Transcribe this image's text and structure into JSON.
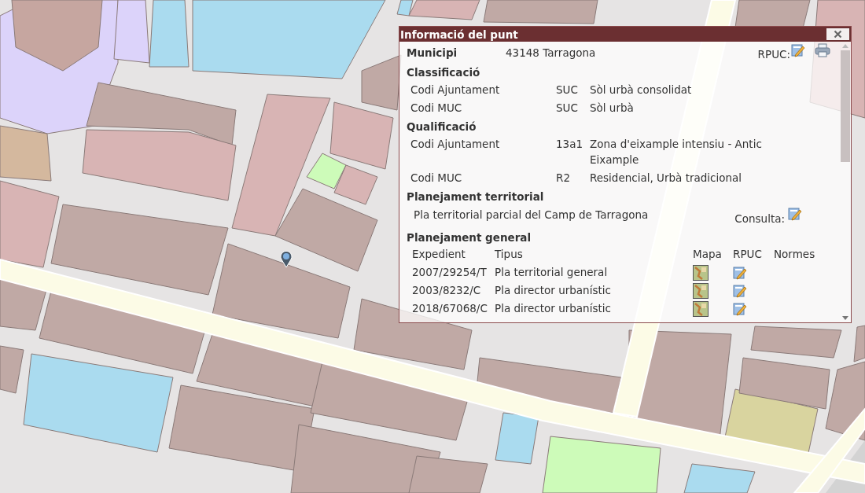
{
  "panel": {
    "title": "Informació del punt",
    "municipi": {
      "label": "Municipi",
      "value": "43148 Tarragona",
      "rpuc_label": "RPUC:"
    },
    "classificacio": {
      "heading": "Classificació",
      "rows": [
        {
          "label": "Codi Ajuntament",
          "code": "SUC",
          "description": "Sòl urbà consolidat"
        },
        {
          "label": "Codi MUC",
          "code": "SUC",
          "description": "Sòl urbà"
        }
      ]
    },
    "qualificacio": {
      "heading": "Qualificació",
      "rows": [
        {
          "label": "Codi Ajuntament",
          "code": "13a1",
          "description": "Zona d'eixample intensiu - Antic Eixample"
        },
        {
          "label": "Codi MUC",
          "code": "R2",
          "description": "Residencial, Urbà tradicional"
        }
      ]
    },
    "planejament_territorial": {
      "heading": "Planejament territorial",
      "plan": "Pla territorial parcial del Camp de Tarragona",
      "consulta_label": "Consulta:"
    },
    "planejament_general": {
      "heading": "Planejament general",
      "columns": [
        "Expedient",
        "Tipus",
        "Mapa",
        "RPUC",
        "Normes"
      ],
      "rows": [
        {
          "expedient": "2007/29254/T",
          "tipus": "Pla territorial general"
        },
        {
          "expedient": "2003/8232/C",
          "tipus": "Pla director urbanístic"
        },
        {
          "expedient": "2018/67068/C",
          "tipus": "Pla director urbanístic"
        }
      ]
    }
  }
}
